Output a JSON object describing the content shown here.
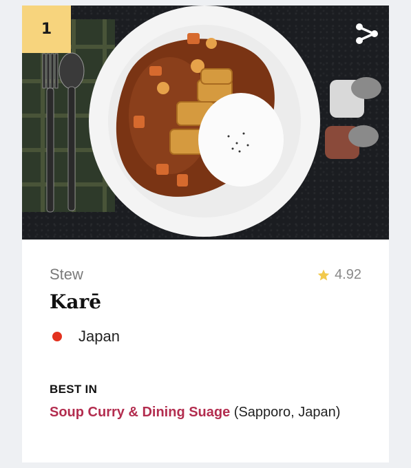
{
  "rank": "1",
  "category": "Stew",
  "rating": "4.92",
  "dish_name": "Karē",
  "country": "Japan",
  "best_in": {
    "label": "BEST IN",
    "restaurant": "Soup Curry & Dining Suage",
    "location": " (Sapporo, Japan)"
  },
  "colors": {
    "rank_badge": "#f7d47d",
    "restaurant_link": "#b32d4f",
    "country_dot": "#e3321f",
    "star": "#f2c94c"
  },
  "icons": [
    "share-icon",
    "star-icon"
  ]
}
